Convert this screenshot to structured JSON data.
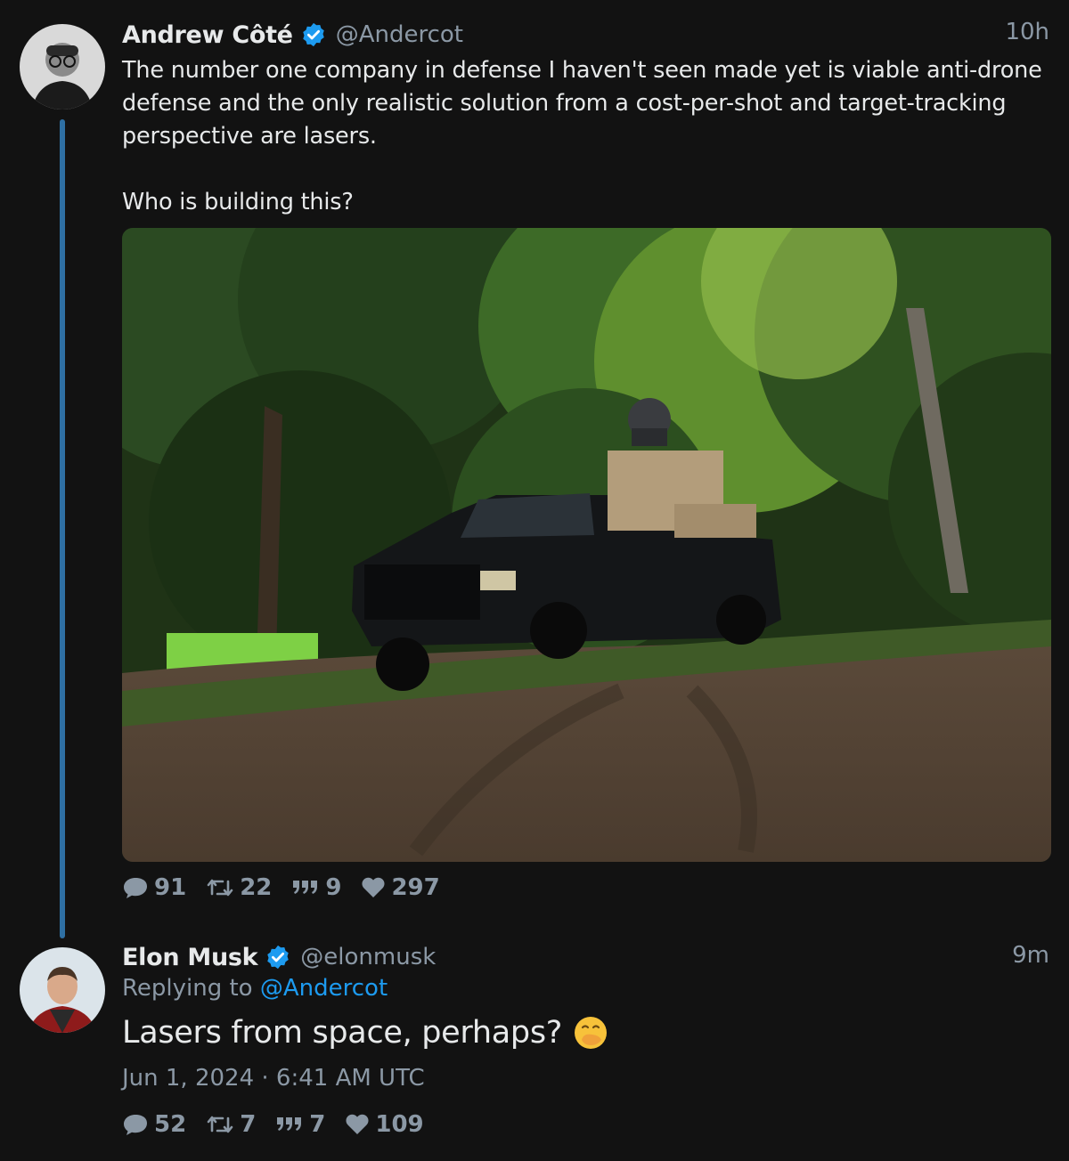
{
  "thread": {
    "original": {
      "display_name": "Andrew Côté",
      "handle": "@Andercot",
      "time": "10h",
      "text": "The number one company in defense I haven't seen made yet is viable anti-drone defense and the only realistic solution from a cost-per-shot and target-tracking perspective are lasers.\n\nWho is building this?",
      "media_icon": "photo-black-pickup-truck-with-turret",
      "stats": {
        "replies": "91",
        "retweets": "22",
        "quotes": "9",
        "likes": "297"
      }
    },
    "reply": {
      "display_name": "Elon Musk",
      "handle": "@elonmusk",
      "time": "9m",
      "replying_label": "Replying to",
      "replying_handle": "@Andercot",
      "text": "Lasers from space, perhaps?",
      "emoji": "face-with-hand-over-mouth",
      "timestamp": "Jun 1, 2024 · 6:41 AM UTC",
      "stats": {
        "replies": "52",
        "retweets": "7",
        "quotes": "7",
        "likes": "109"
      }
    }
  },
  "colors": {
    "background": "#121212",
    "text": "#e7e9ea",
    "muted": "#8b98a5",
    "link": "#1d9bf0",
    "thread_line": "#2e6fa3",
    "verified": "#1d9bf0"
  },
  "icons": [
    "verified-badge-icon",
    "reply-icon",
    "retweet-icon",
    "quote-icon",
    "like-icon"
  ]
}
